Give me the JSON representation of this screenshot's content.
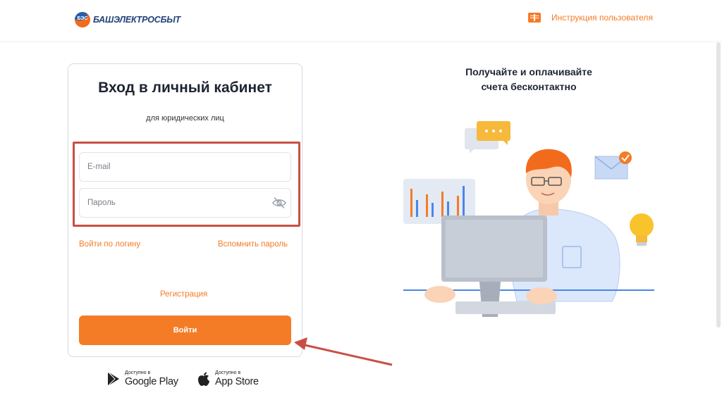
{
  "header": {
    "logo_mark": "БЭС",
    "logo_name": "БАШЭЛЕКТРОСБЫТ",
    "manual_icon": "book-icon",
    "manual_label": "Инструкция пользователя"
  },
  "login": {
    "title": "Вход в личный кабинет",
    "subtitle": "для юридических лиц",
    "email_placeholder": "E-mail",
    "password_placeholder": "Пароль",
    "password_toggle_icon": "eye-off-icon",
    "login_by_username": "Войти по логину",
    "remind_password": "Вспомнить пароль",
    "register": "Регистрация",
    "submit": "Войти"
  },
  "stores": {
    "google_small": "Доступно в",
    "google_big": "Google Play",
    "apple_small": "Доступно в",
    "apple_big": "App Store"
  },
  "promo": {
    "line1": "Получайте и оплачивайте",
    "line2": "счета бесконтактно"
  },
  "colors": {
    "accent": "#f47c26",
    "annotation": "#c94f45",
    "title": "#1f2433"
  }
}
